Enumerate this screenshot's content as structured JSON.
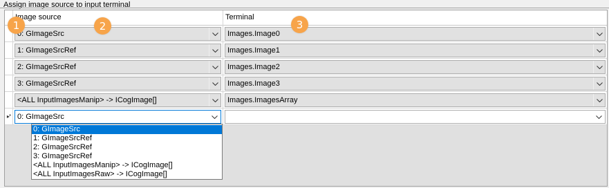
{
  "window": {
    "group_title": "Assign image source to input terminal"
  },
  "grid": {
    "columns": [
      "Image source",
      "Terminal"
    ],
    "rows": [
      {
        "source": "0: GImageSrc",
        "terminal": "Images.Image0"
      },
      {
        "source": "1: GImageSrcRef",
        "terminal": "Images.Image1"
      },
      {
        "source": "2: GImageSrcRef",
        "terminal": "Images.Image2"
      },
      {
        "source": "3: GImageSrcRef",
        "terminal": "Images.Image3"
      },
      {
        "source": "<ALL InputImagesManip> -> ICogImage[]",
        "terminal": "Images.ImagesArray"
      }
    ],
    "new_row": {
      "marker": "▸*",
      "source": "0: GImageSrc",
      "terminal": ""
    }
  },
  "dropdown": {
    "options": [
      "0: GImageSrc",
      "1: GImageSrcRef",
      "2: GImageSrcRef",
      "3: GImageSrcRef",
      "<ALL InputImagesManip> -> ICogImage[]",
      "<ALL InputImagesRaw> -> ICogImage[]"
    ],
    "selected": "0: GImageSrc"
  },
  "badges": [
    "1",
    "2",
    "3"
  ],
  "colors": {
    "accent": "#0078d7",
    "badge": "#f7a44a",
    "grid_bg": "#e0e0e0"
  }
}
